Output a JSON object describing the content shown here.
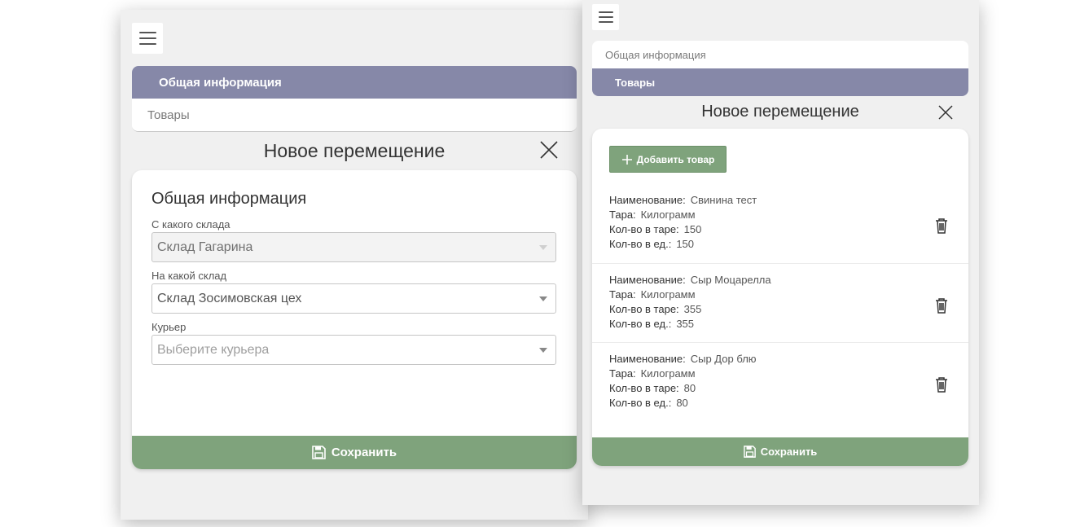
{
  "screen_a": {
    "tabs": [
      {
        "label": "Общая информация",
        "active": true
      },
      {
        "label": "Товары",
        "active": false
      }
    ],
    "modal_title": "Новое перемещение",
    "section_title": "Общая информация",
    "fields": [
      {
        "label": "С какого склада",
        "value": "Склад Гагарина",
        "placeholder": "",
        "disabled": true
      },
      {
        "label": "На какой склад",
        "value": "Склад Зосимовская цех",
        "placeholder": "",
        "disabled": false
      },
      {
        "label": "Курьер",
        "value": "",
        "placeholder": "Выберите курьера",
        "disabled": false
      }
    ],
    "save_label": "Сохранить"
  },
  "screen_b": {
    "tabs": [
      {
        "label": "Общая информация",
        "active": false
      },
      {
        "label": "Товары",
        "active": true
      }
    ],
    "modal_title": "Новое перемещение",
    "add_label": "Добавить товар",
    "field_names": {
      "name": "Наименование:",
      "tare": "Тара:",
      "qty_tare": "Кол-во в таре:",
      "qty_unit": "Кол-во в ед.:"
    },
    "products": [
      {
        "name": "Свинина тест",
        "tare": "Килограмм",
        "qty_tare": "150",
        "qty_unit": "150"
      },
      {
        "name": "Сыр Моцарелла",
        "tare": "Килограмм",
        "qty_tare": "355",
        "qty_unit": "355"
      },
      {
        "name": "Сыр Дор блю",
        "tare": "Килограмм",
        "qty_tare": "80",
        "qty_unit": "80"
      }
    ],
    "save_label": "Сохранить"
  },
  "icons": {
    "menu": "hamburger-menu-icon",
    "close": "close-x-icon",
    "dropdown": "chevron-down-icon",
    "save": "floppy-disk-icon",
    "add": "plus-icon",
    "delete": "trash-icon"
  },
  "colors": {
    "active_tab": "#8688a8",
    "primary_button": "#7fa37c",
    "screen_background": "#f0f0f0"
  }
}
